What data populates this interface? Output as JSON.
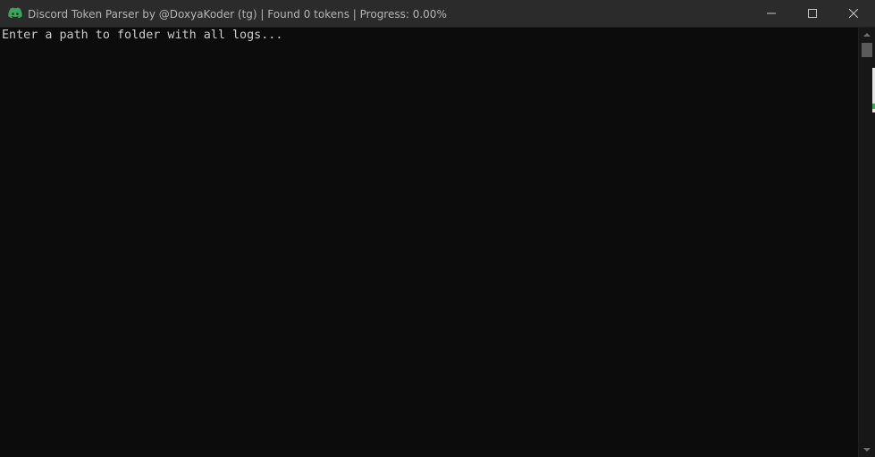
{
  "window": {
    "title": "Discord Token Parser by @DoxyaKoder (tg) | Found 0 tokens | Progress: 0.00%",
    "app_icon": "discord-icon",
    "accent_color": "#3ba55c",
    "controls": {
      "minimize": "minimize-icon",
      "maximize": "maximize-icon",
      "close": "close-icon"
    }
  },
  "console": {
    "lines": [
      "Enter a path to folder with all logs..."
    ],
    "text_color": "#cccccc",
    "background": "#0c0c0c"
  }
}
